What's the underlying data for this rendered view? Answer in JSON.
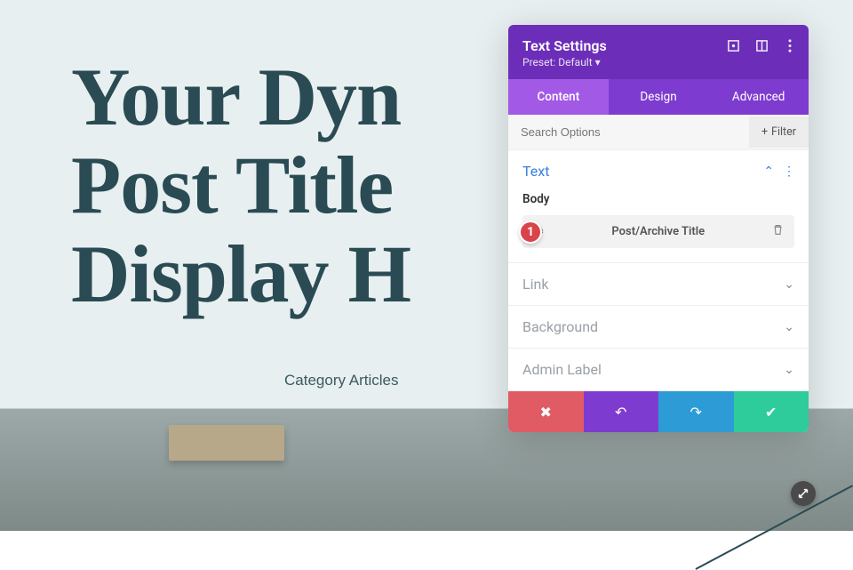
{
  "hero": {
    "title_line1": "Your Dyn",
    "title_line2": "Post Title",
    "title_line3": "Display H",
    "subtitle": "Category Articles"
  },
  "panel": {
    "title": "Text Settings",
    "preset": "Preset: Default",
    "tabs": [
      "Content",
      "Design",
      "Advanced"
    ],
    "active_tab": 0,
    "search_placeholder": "Search Options",
    "filter_label": "Filter",
    "sections": {
      "text": "Text",
      "body_label": "Body",
      "dynamic_value": "Post/Archive Title",
      "link": "Link",
      "background": "Background",
      "admin_label": "Admin Label"
    },
    "callout": "1"
  }
}
